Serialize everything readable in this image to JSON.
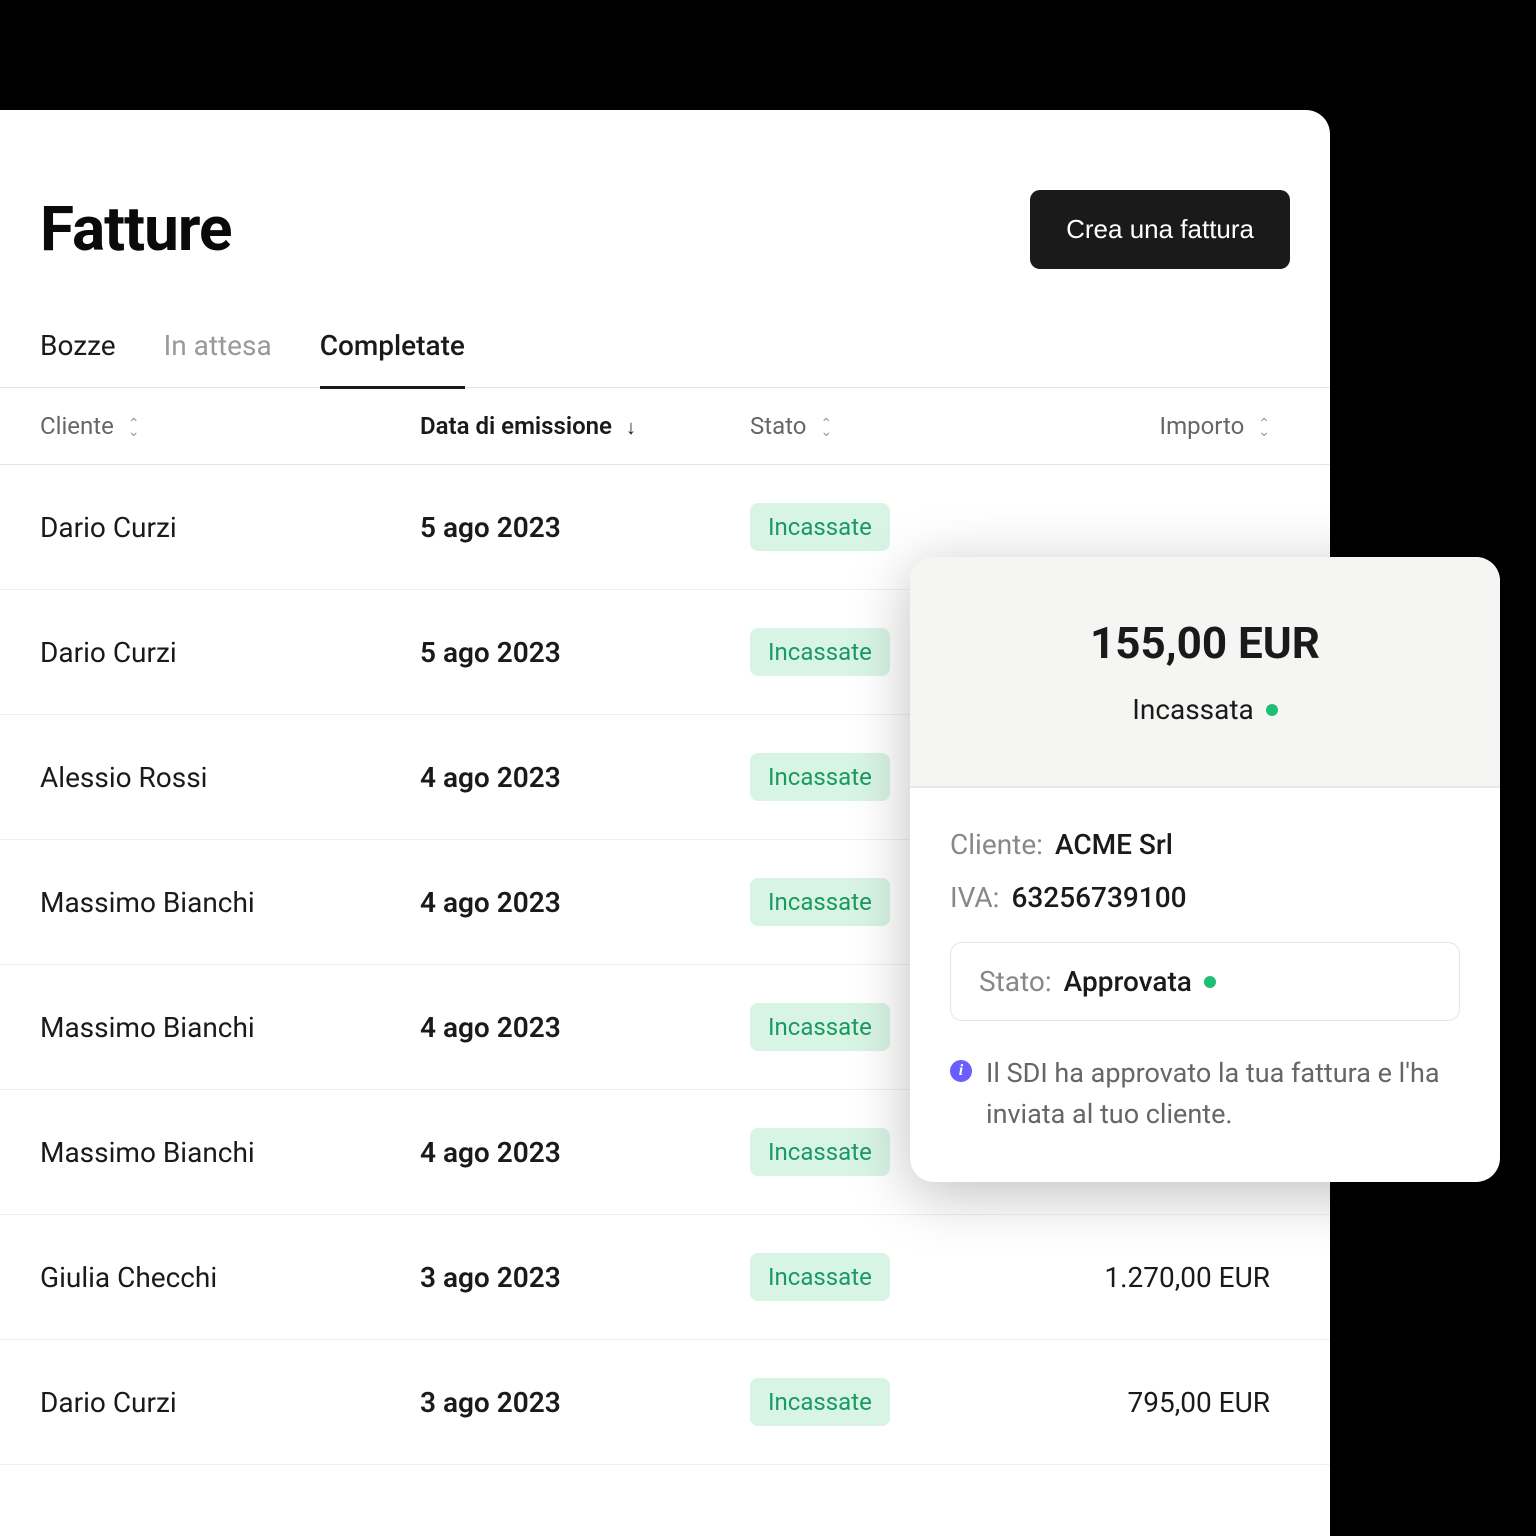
{
  "header": {
    "title": "Fatture",
    "create_button": "Crea una fattura"
  },
  "tabs": [
    {
      "label": "Bozze",
      "active": false
    },
    {
      "label": "In attesa",
      "active": false
    },
    {
      "label": "Completate",
      "active": true
    }
  ],
  "columns": {
    "cliente": "Cliente",
    "data": "Data di emissione",
    "stato": "Stato",
    "importo": "Importo"
  },
  "rows": [
    {
      "cliente": "Dario Curzi",
      "data": "5 ago 2023",
      "stato": "Incassate",
      "importo": ""
    },
    {
      "cliente": "Dario Curzi",
      "data": "5 ago 2023",
      "stato": "Incassate",
      "importo": ""
    },
    {
      "cliente": "Alessio Rossi",
      "data": "4 ago 2023",
      "stato": "Incassate",
      "importo": ""
    },
    {
      "cliente": "Massimo Bianchi",
      "data": "4 ago 2023",
      "stato": "Incassate",
      "importo": ""
    },
    {
      "cliente": "Massimo Bianchi",
      "data": "4 ago 2023",
      "stato": "Incassate",
      "importo": ""
    },
    {
      "cliente": "Massimo Bianchi",
      "data": "4 ago 2023",
      "stato": "Incassate",
      "importo": ""
    },
    {
      "cliente": "Giulia Checchi",
      "data": "3 ago 2023",
      "stato": "Incassate",
      "importo": "1.270,00 EUR"
    },
    {
      "cliente": "Dario Curzi",
      "data": "3 ago 2023",
      "stato": "Incassate",
      "importo": "795,00 EUR"
    }
  ],
  "detail": {
    "amount": "155,00 EUR",
    "status": "Incassata",
    "cliente_label": "Cliente:",
    "cliente_value": "ACME Srl",
    "iva_label": "IVA:",
    "iva_value": "63256739100",
    "stato_label": "Stato:",
    "stato_value": "Approvata",
    "info_text": "Il SDI ha approvato la tua fattura e l'ha inviata al tuo cliente."
  }
}
